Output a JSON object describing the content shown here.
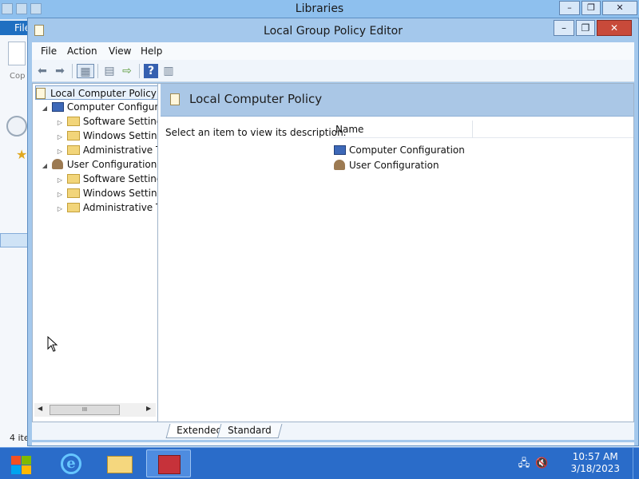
{
  "background_window": {
    "title": "Libraries",
    "ribbon_tab": "File",
    "copy_label": "Cop",
    "item_count": "4 ite"
  },
  "window": {
    "title": "Local Group Policy Editor"
  },
  "menu": [
    "File",
    "Action",
    "View",
    "Help"
  ],
  "tree": {
    "root": "Local Computer Policy",
    "computer_config": "Computer Configura",
    "user_config": "User Configuration",
    "computer_children": [
      "Software Settings",
      "Windows Setting",
      "Administrative Te"
    ],
    "user_children": [
      "Software Settings",
      "Windows Setting",
      "Administrative Te"
    ],
    "scroll_thumb": "III"
  },
  "details": {
    "banner_title": "Local Computer Policy",
    "description": "Select an item to view its description.",
    "column_name": "Name",
    "items": [
      "Computer Configuration",
      "User Configuration"
    ]
  },
  "tabs": [
    "Extended",
    "Standard"
  ],
  "taskbar": {
    "time": "10:57 AM",
    "date": "3/18/2023"
  },
  "colors": {
    "accent": "#2a6cc9",
    "window_frame": "#a4c8ec",
    "banner": "#aac7e6"
  }
}
